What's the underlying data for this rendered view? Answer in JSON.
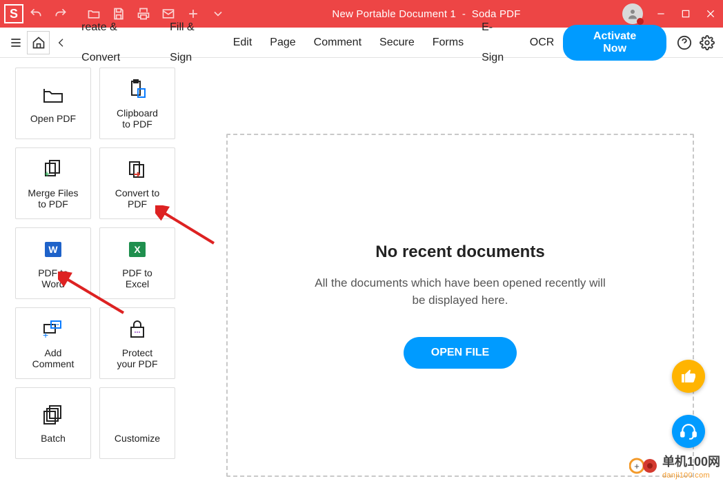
{
  "title": {
    "doc": "New Portable Document 1",
    "sep": "  -  ",
    "app": "Soda PDF"
  },
  "toolbar": {
    "menu": [
      "reate & Convert",
      "Fill & Sign",
      "Edit",
      "Page",
      "Comment",
      "Secure",
      "Forms",
      "E-Sign",
      "OCR"
    ],
    "activate": "Activate Now"
  },
  "tools": [
    {
      "id": "open-pdf",
      "label": "Open PDF",
      "icon": "folder"
    },
    {
      "id": "clipboard-pdf",
      "label": "Clipboard\nto PDF",
      "icon": "clipboard"
    },
    {
      "id": "merge",
      "label": "Merge Files\nto PDF",
      "icon": "merge"
    },
    {
      "id": "convert",
      "label": "Convert to\nPDF",
      "icon": "convert"
    },
    {
      "id": "to-word",
      "label": "PDF to\nWord",
      "icon": "word"
    },
    {
      "id": "to-excel",
      "label": "PDF to\nExcel",
      "icon": "excel"
    },
    {
      "id": "add-comment",
      "label": "Add\nComment",
      "icon": "comment"
    },
    {
      "id": "protect",
      "label": "Protect\nyour PDF",
      "icon": "lock"
    },
    {
      "id": "batch",
      "label": "Batch",
      "icon": "batch"
    },
    {
      "id": "customize",
      "label": "Customize",
      "icon": ""
    }
  ],
  "dropzone": {
    "title": "No recent documents",
    "subtitle": "All the documents which have been opened recently will be displayed here.",
    "button": "OPEN FILE"
  },
  "watermark": {
    "big": "单机100网",
    "small": "danji100.com"
  }
}
